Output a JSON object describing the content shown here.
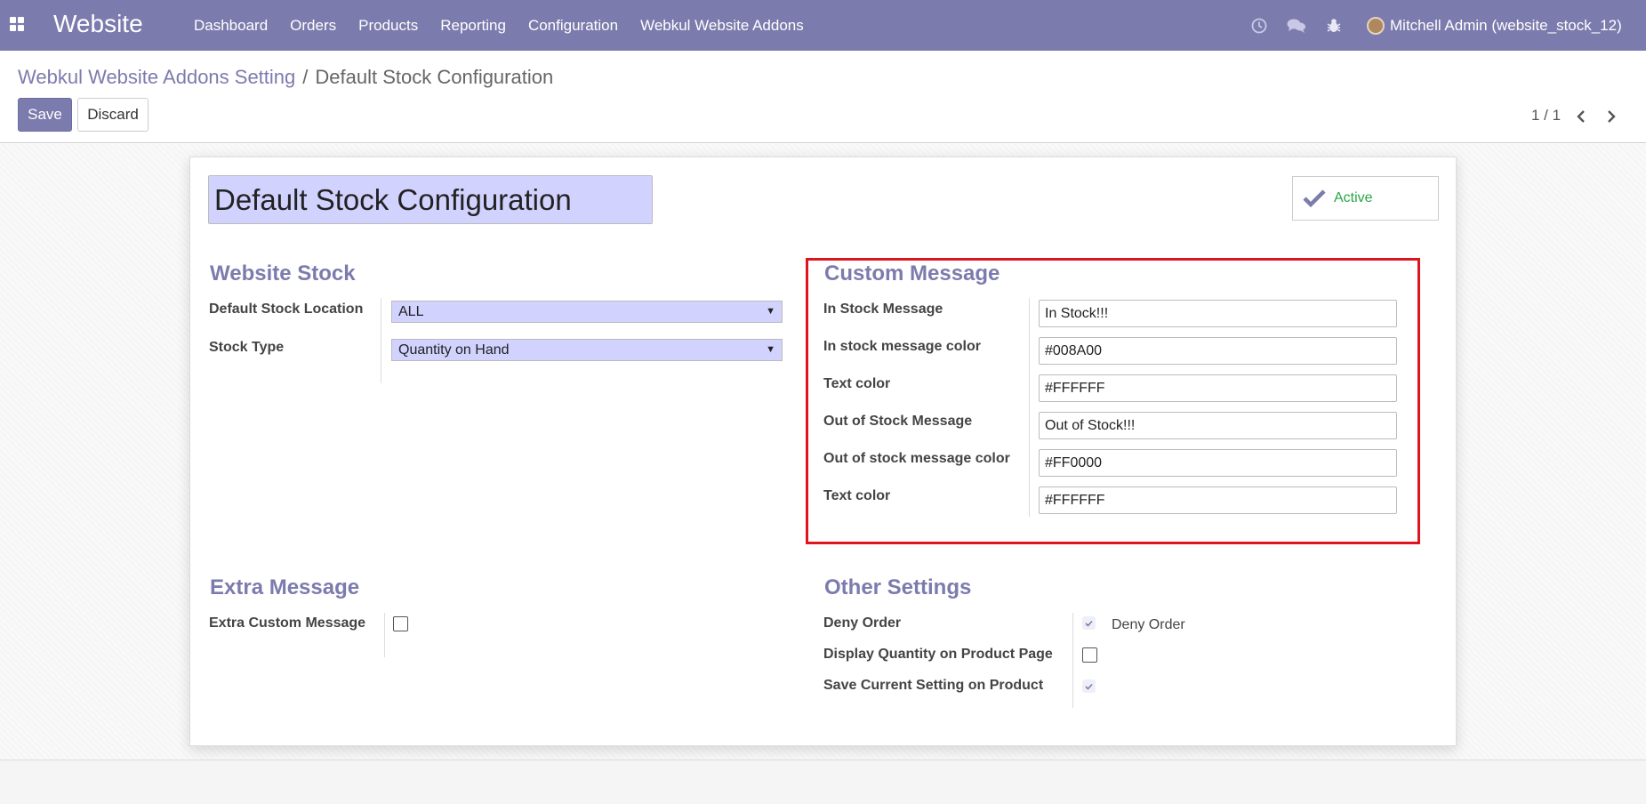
{
  "navbar": {
    "app_name": "Website",
    "menu": [
      "Dashboard",
      "Orders",
      "Products",
      "Reporting",
      "Configuration",
      "Webkul Website Addons"
    ],
    "user": "Mitchell Admin (website_stock_12)"
  },
  "breadcrumb": {
    "parent": "Webkul Website Addons Setting",
    "separator": "/",
    "current": "Default Stock Configuration"
  },
  "buttons": {
    "save": "Save",
    "discard": "Discard"
  },
  "pager": {
    "value": "1 / 1"
  },
  "form": {
    "name": "Default Stock Configuration",
    "active_label": "Active",
    "website_stock": {
      "title": "Website Stock",
      "default_stock_location_label": "Default Stock Location",
      "default_stock_location_value": "ALL",
      "stock_type_label": "Stock Type",
      "stock_type_value": "Quantity on Hand"
    },
    "custom_message": {
      "title": "Custom Message",
      "fields": [
        {
          "label": "In Stock Message",
          "value": "In Stock!!!"
        },
        {
          "label": "In stock message color",
          "value": "#008A00"
        },
        {
          "label": "Text color",
          "value": "#FFFFFF"
        },
        {
          "label": "Out of Stock Message",
          "value": "Out of Stock!!!"
        },
        {
          "label": "Out of stock message color",
          "value": "#FF0000"
        },
        {
          "label": "Text color",
          "value": "#FFFFFF"
        }
      ]
    },
    "extra_message": {
      "title": "Extra Message",
      "extra_custom_message_label": "Extra Custom Message",
      "extra_custom_message_checked": false
    },
    "other_settings": {
      "title": "Other Settings",
      "deny_order_label": "Deny Order",
      "deny_order_checked": true,
      "deny_order_inline_label": "Deny Order",
      "display_quantity_label": "Display Quantity on Product Page",
      "display_quantity_checked": false,
      "save_current_setting_label": "Save Current Setting on Product",
      "save_current_setting_checked": true
    }
  },
  "colors": {
    "brand": "#7C7BAD",
    "active_green": "#28A745",
    "highlight_red": "#E0141E",
    "input_required": "#D2D2FF"
  }
}
